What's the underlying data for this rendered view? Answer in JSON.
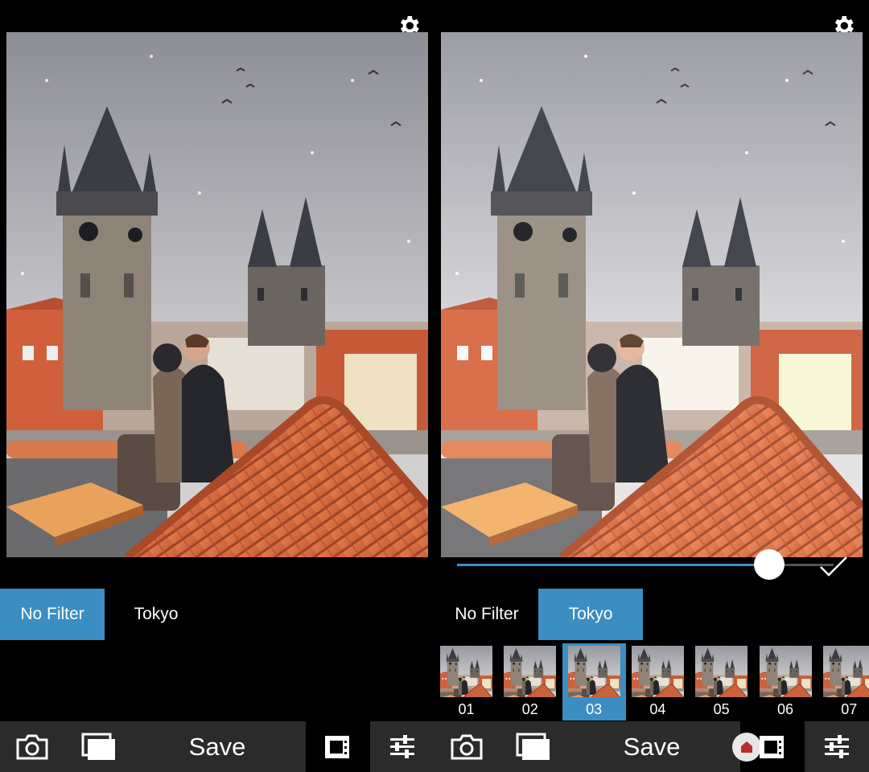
{
  "left": {
    "filter_tabs": [
      {
        "label": "No Filter",
        "active": true
      },
      {
        "label": "Tokyo",
        "active": false
      }
    ],
    "toolbar": {
      "save_label": "Save"
    }
  },
  "right": {
    "filter_tabs": [
      {
        "label": "No Filter",
        "active": false
      },
      {
        "label": "Tokyo",
        "active": true
      }
    ],
    "slider": {
      "value": 0.83
    },
    "thumbnails": [
      "01",
      "02",
      "03",
      "04",
      "05",
      "06",
      "07"
    ],
    "selected_thumbnail": "03",
    "toolbar": {
      "save_label": "Save"
    }
  },
  "icons": {
    "settings": "gear-icon",
    "camera": "camera-icon",
    "gallery": "gallery-icon",
    "film": "film-icon",
    "adjust": "sliders-icon",
    "confirm": "checkmark-icon",
    "logo": "watermark-logo"
  },
  "colors": {
    "accent": "#3b8dc2",
    "toolbar": "#2b2b2b",
    "roof": "#d4693e"
  }
}
